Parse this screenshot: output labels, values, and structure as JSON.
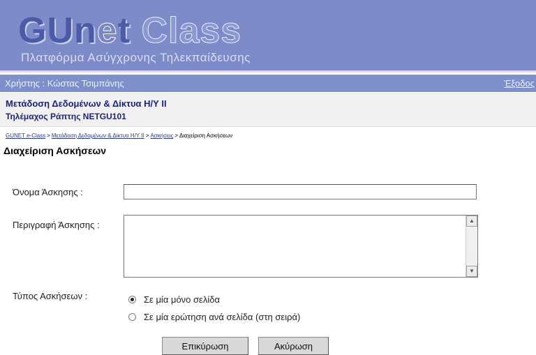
{
  "header": {
    "logo_part1": "GUn",
    "logo_part2": "e",
    "logo_part3": "t ",
    "logo_part4": "Class",
    "subtitle": "Πλατφόρμα Ασύγχρονης Τηλεκπαίδευσης"
  },
  "userbar": {
    "user_label": "Χρήστης : Κώστας Τσιμπάνης",
    "logout_label": "Έξοδος"
  },
  "course": {
    "title": "Μετάδοση Δεδομένων & Δίκτυα Η/Υ ΙΙ",
    "teacher_code": "Τηλέμαχος Ράπτης NETGU101"
  },
  "breadcrumb": {
    "items": [
      "GUNET e-Class",
      "Μετάδοση Δεδομένων & Δίκτυα Η/Υ ΙΙ",
      "Ασκήσεις"
    ],
    "separator": ">",
    "current": "Διαχείριση Ασκήσεων"
  },
  "page_title": "Διαχείριση Ασκήσεων",
  "form": {
    "name_label": "Όνομα Άσκησης :",
    "name_value": "",
    "desc_label": "Περιγραφή Άσκησης :",
    "desc_value": "",
    "type_label": "Τύπος Ασκήσεων :",
    "options": [
      {
        "label": "Σε μία μόνο σελίδα",
        "checked": true
      },
      {
        "label": "Σε μία ερώτηση ανά σελίδα (στη σειρά)",
        "checked": false
      }
    ],
    "submit_label": "Επικύρωση",
    "cancel_label": "Ακύρωση"
  },
  "icons": {
    "scroll_up": "scroll-up-arrow-icon",
    "scroll_down": "scroll-down-arrow-icon"
  },
  "colors": {
    "banner": "#7d8bc8",
    "userbar": "#7f8fc9",
    "course_title": "#1a237e",
    "link": "#2c3a8a"
  }
}
